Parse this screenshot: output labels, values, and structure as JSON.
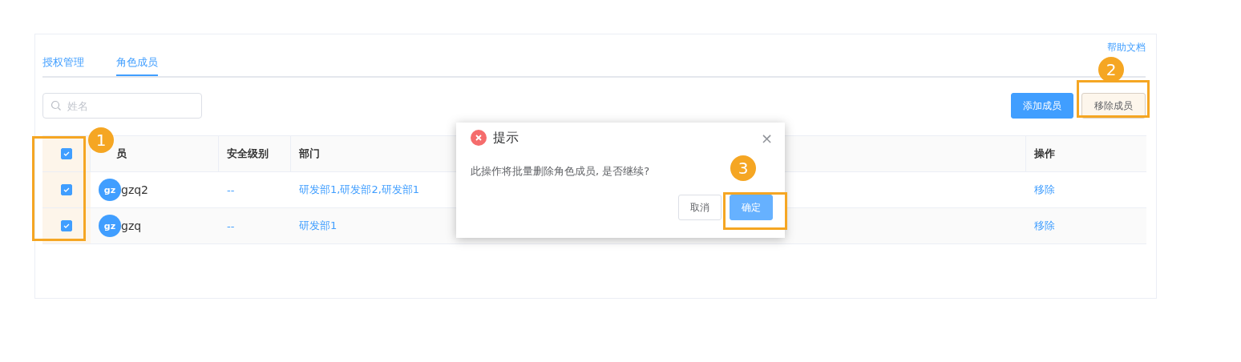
{
  "help_link": "帮助文档",
  "tabs": [
    {
      "label": "授权管理",
      "selected": false
    },
    {
      "label": "角色成员",
      "selected": true
    }
  ],
  "search": {
    "placeholder": "姓名"
  },
  "buttons": [
    {
      "label": "添加成员",
      "kind": "primary"
    },
    {
      "label": "移除成员",
      "kind": "default"
    }
  ],
  "table": {
    "all_checked": true,
    "columns": [
      "员",
      "安全级别",
      "部门",
      "操作"
    ],
    "rows": [
      {
        "checked": true,
        "avatar": "gz",
        "name": "gzq2",
        "security": "--",
        "department": "研发部1,研发部2,研发部1",
        "action": "移除"
      },
      {
        "checked": true,
        "avatar": "gz",
        "name": "gzq",
        "security": "--",
        "department": "研发部1",
        "action": "移除"
      }
    ]
  },
  "dialog": {
    "title": "提示",
    "close": "×",
    "message": "此操作将批量删除角色成员, 是否继续?",
    "buttons": [
      {
        "label": "取消",
        "kind": "default"
      },
      {
        "label": "确定",
        "kind": "primary"
      }
    ]
  },
  "annotations": [
    {
      "number": "1",
      "kind": "checkboxes"
    },
    {
      "number": "2",
      "kind": "remove"
    },
    {
      "number": "3",
      "kind": "confirm"
    }
  ]
}
